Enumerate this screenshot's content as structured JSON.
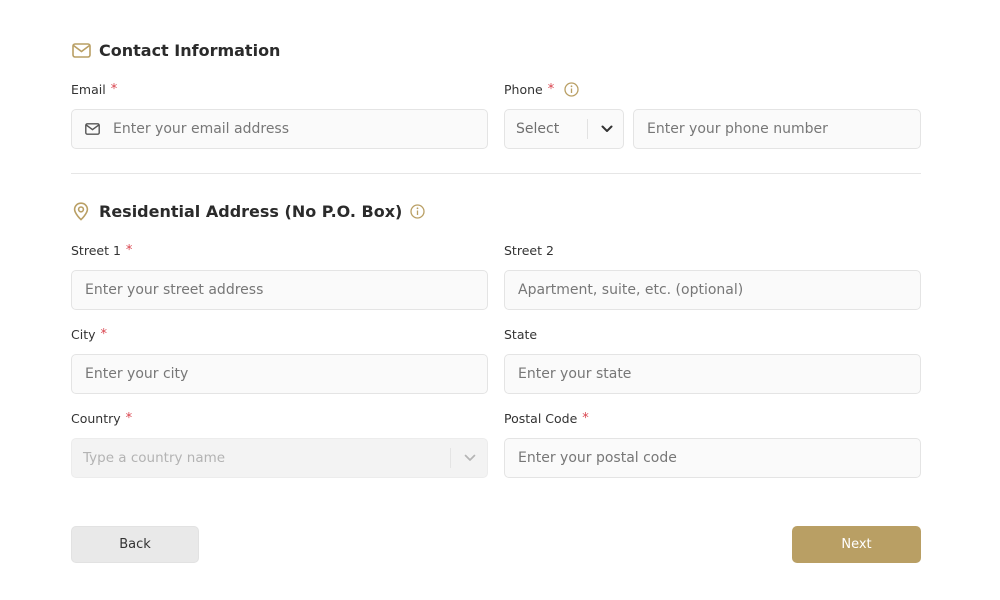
{
  "colors": {
    "accent": "#b99f64",
    "required": "#d9434d",
    "text": "#2b2b2b",
    "border": "#e4e4e4",
    "field_bg": "#fafafa"
  },
  "contact": {
    "title": "Contact Information",
    "icon": "mail-icon",
    "email": {
      "label": "Email",
      "required_mark": "*",
      "placeholder": "Enter your email address",
      "icon": "mail-icon"
    },
    "phone": {
      "label": "Phone",
      "required_mark": "*",
      "info_icon": "info-icon",
      "code_select": "Select",
      "placeholder": "Enter your phone number"
    }
  },
  "address": {
    "title": "Residential Address (No P.O. Box)",
    "icon": "map-pin-icon",
    "info_icon": "info-icon",
    "street1": {
      "label": "Street 1",
      "required_mark": "*",
      "placeholder": "Enter your street address"
    },
    "street2": {
      "label": "Street 2",
      "placeholder": "Apartment, suite, etc. (optional)"
    },
    "city": {
      "label": "City",
      "required_mark": "*",
      "placeholder": "Enter your city"
    },
    "state": {
      "label": "State",
      "placeholder": "Enter your state"
    },
    "country": {
      "label": "Country",
      "required_mark": "*",
      "placeholder": "Type a country name"
    },
    "postal": {
      "label": "Postal Code",
      "required_mark": "*",
      "placeholder": "Enter your postal code"
    }
  },
  "actions": {
    "back_label": "Back",
    "next_label": "Next"
  }
}
